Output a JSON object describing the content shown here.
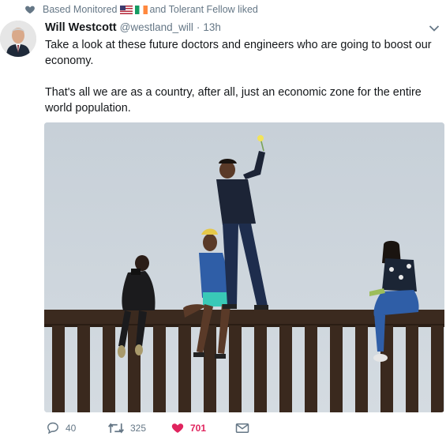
{
  "social_context": {
    "prefix": "Based Monitored",
    "suffix": "and Tolerant Fellow liked",
    "icon": "heart-icon"
  },
  "tweet": {
    "author_name": "Will Westcott",
    "handle": "@westland_will",
    "separator": "·",
    "time": "13h",
    "text": "Take a look at these future doctors and engineers who are going to boost our economy.\n\nThat's all we are as a country, after all, just an economic zone for the entire world population.",
    "media_icon": "photo-people-on-border-fence"
  },
  "actions": {
    "reply_count": "40",
    "retweet_count": "325",
    "like_count": "701"
  },
  "colors": {
    "text_primary": "#14171a",
    "text_secondary": "#657786",
    "like_active": "#e0245e",
    "sky": "#c9d1d9",
    "fence": "#3b2a1f"
  }
}
